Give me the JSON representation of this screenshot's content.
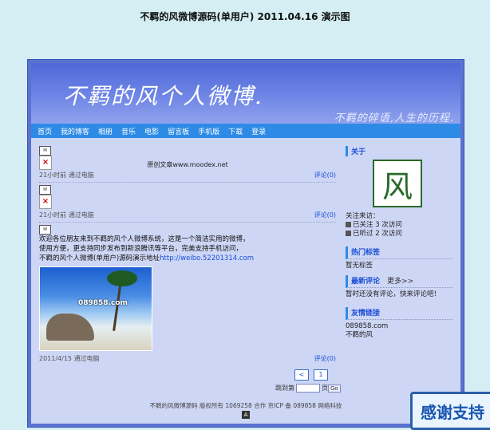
{
  "page_title": "不羁的风微博源码(单用户) 2011.04.16 演示图",
  "banner": {
    "title": "不羁的风个人微博.",
    "slogan": "不羁的碎语,人生的历程."
  },
  "nav": [
    "首页",
    "我的博客",
    "相册",
    "音乐",
    "电影",
    "留言板",
    "手机版",
    "下载",
    "登录"
  ],
  "posts": [
    {
      "text": "原创文章www.moodex.net",
      "time": "21小时前 通过电脑",
      "comment": "评论(0)"
    },
    {
      "time": "21小时前 通过电脑",
      "comment": "评论(0)"
    },
    {
      "lines": [
        "欢迎各位朋友来到不羁的风个人微博系统，这是一个简洁实用的微博，",
        "使用方便，更支持同步发布到新浪腾讯等平台，完美支持手机访问，",
        "不羁的风个人微博(单用户)源码演示地址"
      ],
      "link": "http://weibo.52201314.com",
      "photo_caption": "089858.com",
      "time": "2011/4/15 通过电脑",
      "comment": "评论(0)"
    }
  ],
  "pager": {
    "prev": "<",
    "next": "1",
    "goto_label": "跳到第",
    "goto_suffix": "页",
    "goto_button": "Go"
  },
  "sidebar": {
    "about_head": "关于",
    "avatar_char": "风",
    "lines": [
      "关注来访：",
      "已关注 3 次访问",
      "已听过 2 次访问"
    ],
    "hot_head": "热门标签",
    "hot_text": "暂无标签",
    "latest_head": "最新评论",
    "latest_more": "更多>>",
    "latest_text": "暂时还没有评论，快来评论吧！",
    "links_head": "友情链接",
    "links": [
      "089858.com",
      "不羁的风"
    ]
  },
  "footer": "不羁的风微博源码 版权所有 1069258 合作 京ICP 备 089858 网络科技",
  "thanks_button": "感谢支持"
}
